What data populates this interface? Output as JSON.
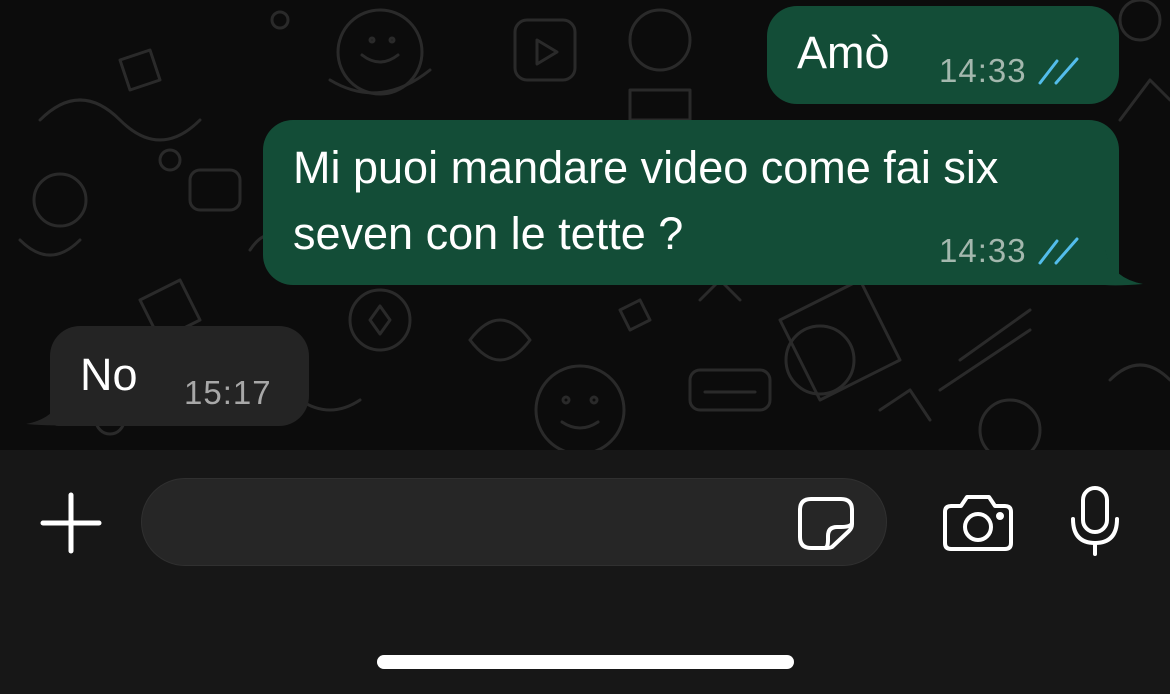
{
  "messages": [
    {
      "direction": "outgoing",
      "text_lines": [
        "Amò"
      ],
      "time": "14:33",
      "status": "read"
    },
    {
      "direction": "outgoing",
      "text_lines": [
        "Mi puoi mandare video come fai six",
        "seven con le tette ?"
      ],
      "time": "14:33",
      "status": "read"
    },
    {
      "direction": "incoming",
      "text_lines": [
        "No"
      ],
      "time": "15:17"
    }
  ],
  "composer": {
    "placeholder": "",
    "attach_icon": "plus-icon",
    "sticker_icon": "sticker-icon",
    "camera_icon": "camera-icon",
    "mic_icon": "microphone-icon"
  },
  "colors": {
    "outgoing_bubble": "#134d37",
    "incoming_bubble": "#242424",
    "read_ticks": "#53bdeb",
    "background": "#0c0c0c"
  }
}
